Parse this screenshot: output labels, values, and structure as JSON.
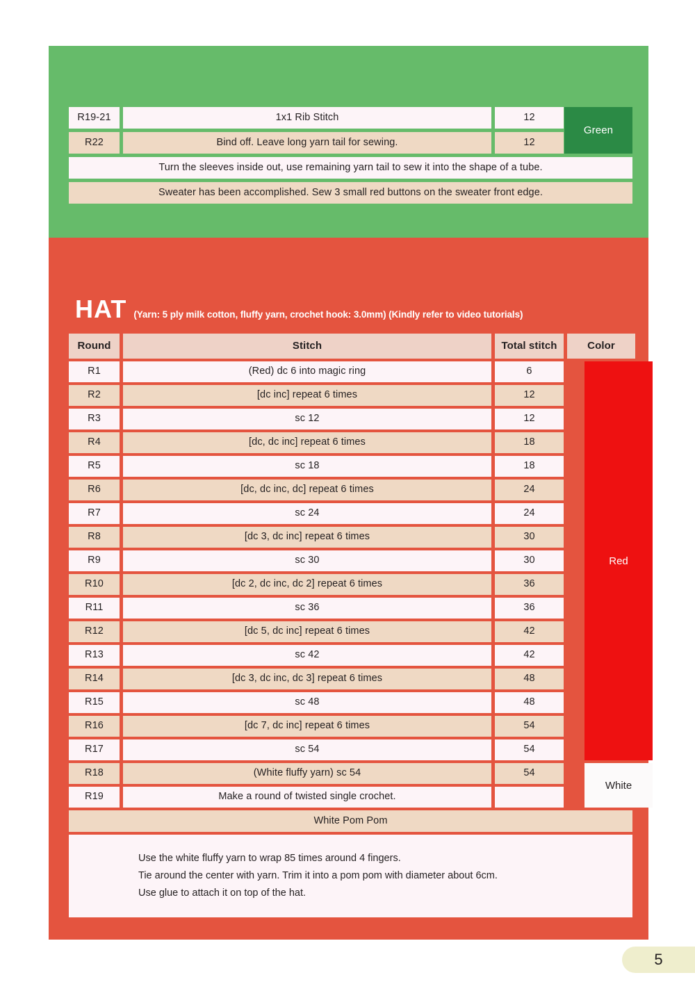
{
  "page": {
    "number": "5",
    "panel_colors": {
      "green": "#66bb6a",
      "red": "#e4543f",
      "swatch_green": "#2b8a45",
      "swatch_red": "#ee1111",
      "swatch_white": "#fcfafa",
      "row_light": "#fdf4f8",
      "row_beige": "#efd9c4",
      "header_bg": "#eed2c7"
    }
  },
  "sweater_section": {
    "rows": [
      {
        "round": "R19-21",
        "stitch": "1x1 Rib Stitch",
        "total": "12"
      },
      {
        "round": "R22",
        "stitch": "Bind off. Leave long yarn tail for sewing.",
        "total": "12"
      }
    ],
    "color_label": "Green",
    "notes": [
      "Turn the sleeves inside out, use remaining yarn tail to sew it into the shape of a tube.",
      "Sweater has been accomplished. Sew 3 small red buttons on the sweater front edge."
    ]
  },
  "hat_section": {
    "title": "HAT",
    "subtitle": "(Yarn: 5 ply milk cotton, fluffy yarn, crochet hook: 3.0mm) (Kindly refer to video tutorials)",
    "headers": {
      "round": "Round",
      "stitch": "Stitch",
      "total": "Total stitch",
      "color": "Color"
    },
    "color_labels": {
      "red": "Red",
      "white": "White"
    },
    "rows": [
      {
        "round": "R1",
        "stitch": "(Red) dc 6 into magic ring",
        "total": "6"
      },
      {
        "round": "R2",
        "stitch": "[dc inc] repeat 6 times",
        "total": "12"
      },
      {
        "round": "R3",
        "stitch": "sc 12",
        "total": "12"
      },
      {
        "round": "R4",
        "stitch": "[dc, dc inc] repeat 6 times",
        "total": "18"
      },
      {
        "round": "R5",
        "stitch": "sc 18",
        "total": "18"
      },
      {
        "round": "R6",
        "stitch": "[dc, dc inc, dc] repeat 6 times",
        "total": "24"
      },
      {
        "round": "R7",
        "stitch": "sc 24",
        "total": "24"
      },
      {
        "round": "R8",
        "stitch": "[dc 3, dc inc] repeat 6 times",
        "total": "30"
      },
      {
        "round": "R9",
        "stitch": "sc 30",
        "total": "30"
      },
      {
        "round": "R10",
        "stitch": "[dc 2, dc inc, dc 2] repeat 6 times",
        "total": "36"
      },
      {
        "round": "R11",
        "stitch": "sc 36",
        "total": "36"
      },
      {
        "round": "R12",
        "stitch": "[dc 5, dc inc] repeat 6 times",
        "total": "42"
      },
      {
        "round": "R13",
        "stitch": "sc 42",
        "total": "42"
      },
      {
        "round": "R14",
        "stitch": "[dc 3, dc inc, dc 3] repeat 6 times",
        "total": "48"
      },
      {
        "round": "R15",
        "stitch": "sc 48",
        "total": "48"
      },
      {
        "round": "R16",
        "stitch": "[dc 7, dc inc] repeat 6 times",
        "total": "54"
      },
      {
        "round": "R17",
        "stitch": "sc 54",
        "total": "54"
      },
      {
        "round": "R18",
        "stitch": "(White fluffy yarn) sc 54",
        "total": "54"
      },
      {
        "round": "R19",
        "stitch": "Make a round of twisted single crochet.",
        "total": ""
      }
    ],
    "pom_pom_title": "White Pom Pom",
    "pom_pom_notes": [
      "Use the white fluffy yarn to wrap 85 times around 4 fingers.",
      "Tie around the center with yarn. Trim it into a pom pom with diameter about 6cm.",
      "Use glue to attach it on top of the hat."
    ]
  }
}
